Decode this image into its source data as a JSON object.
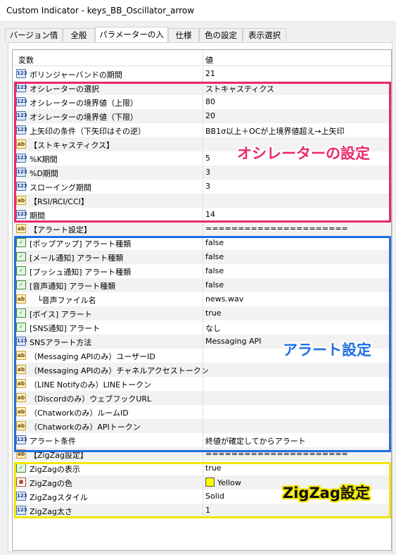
{
  "window": {
    "title": "Custom Indicator - keys_BB_Oscillator_arrow"
  },
  "tabs": [
    {
      "label": "バージョン情報"
    },
    {
      "label": "全般"
    },
    {
      "label": "パラメーターの入力"
    },
    {
      "label": "仕様"
    },
    {
      "label": "色の設定"
    },
    {
      "label": "表示選択"
    }
  ],
  "active_tab": "パラメーターの入力",
  "grid": {
    "headers": {
      "name": "変数",
      "value": "値"
    },
    "rows": [
      {
        "type": "num",
        "name": "ボリンジャーバンドの期間",
        "value": "21"
      },
      {
        "type": "num",
        "name": "オシレーターの選択",
        "value": "ストキャスティクス"
      },
      {
        "type": "num",
        "name": "オシレーターの境界値（上限）",
        "value": "80"
      },
      {
        "type": "num",
        "name": "オシレーターの境界値（下限）",
        "value": "20"
      },
      {
        "type": "num",
        "name": "上矢印の条件（下矢印はその逆）",
        "value": "BB1σ以上＋OCが上境界値超え→上矢印"
      },
      {
        "type": "str",
        "name": "【ストキャスティクス】",
        "value": ""
      },
      {
        "type": "num",
        "name": "%K期間",
        "value": "5"
      },
      {
        "type": "num",
        "name": "%D期間",
        "value": "3"
      },
      {
        "type": "num",
        "name": "スローイング期間",
        "value": "3"
      },
      {
        "type": "str",
        "name": "【RSI/RCI/CCI】",
        "value": ""
      },
      {
        "type": "num",
        "name": "期間",
        "value": "14"
      },
      {
        "type": "str",
        "name": "【アラート設定】",
        "value": "======================"
      },
      {
        "type": "bool",
        "name": "[ポップアップ] アラート種類",
        "value": "false"
      },
      {
        "type": "bool",
        "name": "[メール通知] アラート種類",
        "value": "false"
      },
      {
        "type": "bool",
        "name": "[プッシュ通知] アラート種類",
        "value": "false"
      },
      {
        "type": "bool",
        "name": "[音声通知] アラート種類",
        "value": "false"
      },
      {
        "type": "str",
        "name": "　└音声ファイル名",
        "value": "news.wav"
      },
      {
        "type": "bool",
        "name": "[ボイス] アラート",
        "value": "true"
      },
      {
        "type": "bool",
        "name": "[SNS通知] アラート",
        "value": "なし"
      },
      {
        "type": "num",
        "name": "SNSアラート方法",
        "value": "Messaging API"
      },
      {
        "type": "str",
        "name": "（Messaging APIのみ）ユーザーID",
        "value": ""
      },
      {
        "type": "str",
        "name": "（Messaging APIのみ）チャネルアクセストークン",
        "value": ""
      },
      {
        "type": "str",
        "name": "（LINE Notifyのみ）LINEトークン",
        "value": ""
      },
      {
        "type": "str",
        "name": "（Discordのみ）ウェブフックURL",
        "value": ""
      },
      {
        "type": "str",
        "name": "（Chatworkのみ）ルームID",
        "value": ""
      },
      {
        "type": "str",
        "name": "（Chatworkのみ）APIトークン",
        "value": ""
      },
      {
        "type": "num",
        "name": "アラート条件",
        "value": "終値が確定してからアラート"
      },
      {
        "type": "str",
        "name": "【ZigZag設定】",
        "value": "======================"
      },
      {
        "type": "bool",
        "name": "ZigZagの表示",
        "value": "true"
      },
      {
        "type": "color",
        "name": "ZigZagの色",
        "value": "Yellow",
        "swatch": "#ffff00"
      },
      {
        "type": "num",
        "name": "ZigZagスタイル",
        "value": "Solid"
      },
      {
        "type": "num",
        "name": "ZigZag太さ",
        "value": "1"
      }
    ]
  },
  "annotations": {
    "oscillator": {
      "text": "オシレーターの設定",
      "color": "#ea2a6a"
    },
    "alert": {
      "text": "アラート設定",
      "color": "#1f6fe0"
    },
    "zigzag": {
      "text": "ZigZag設定",
      "color": "#f2e600"
    }
  }
}
